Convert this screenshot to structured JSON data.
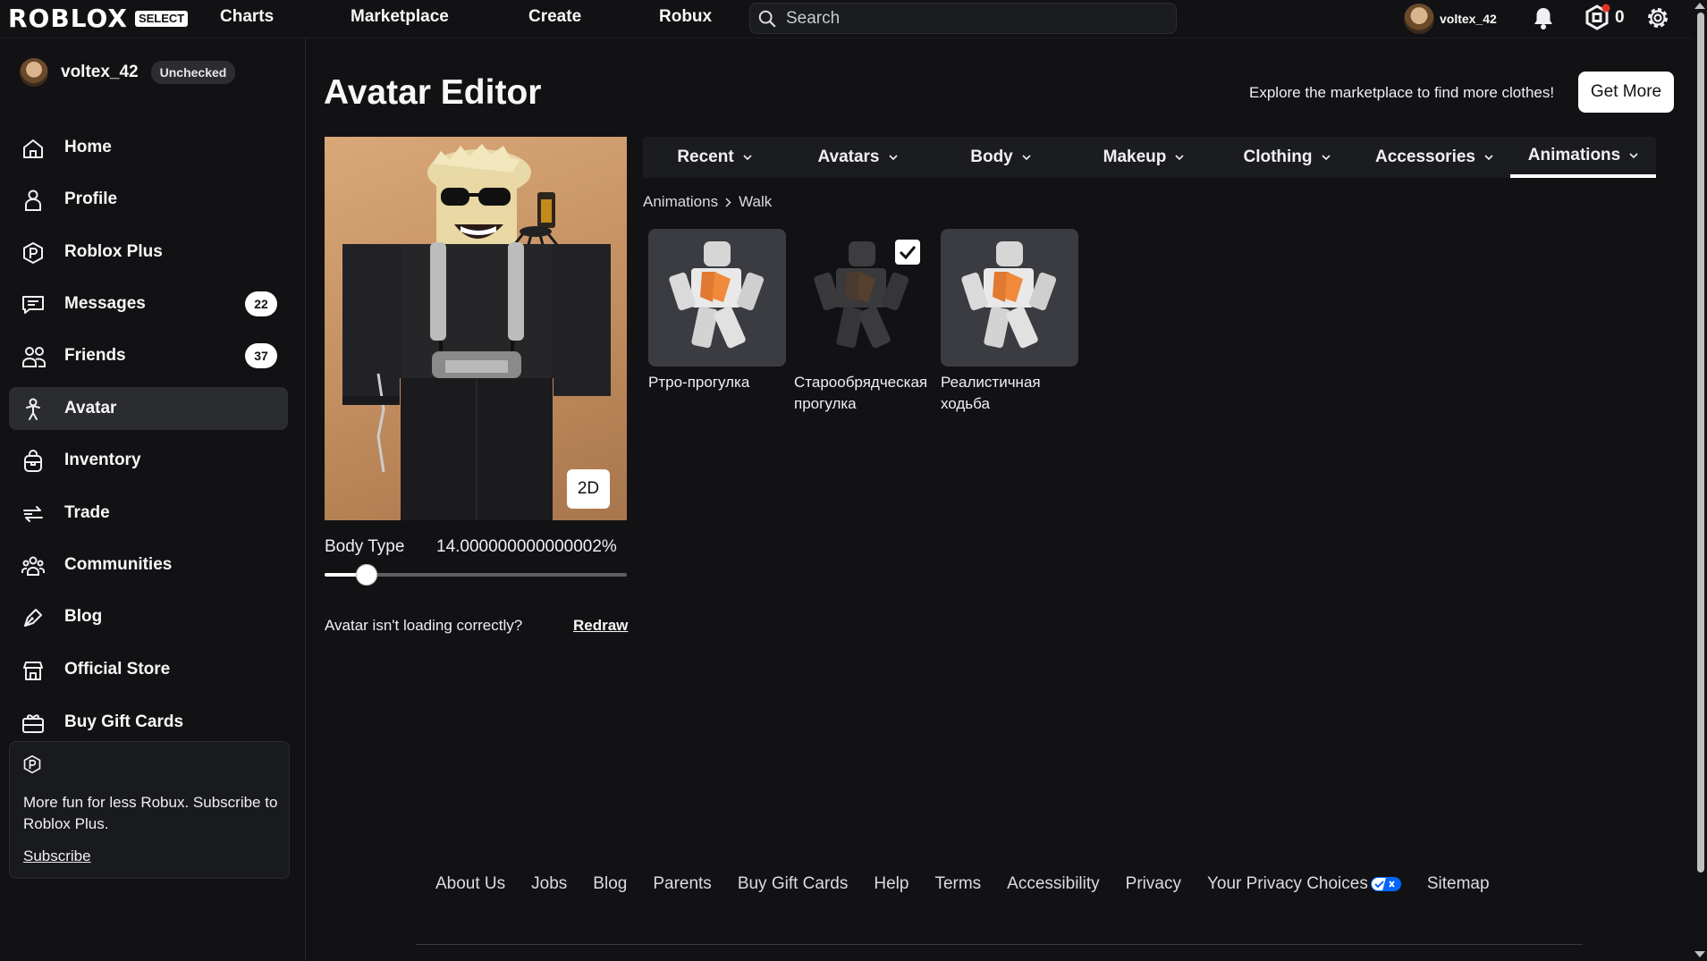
{
  "nav": {
    "logo_text": "ROBLOX",
    "logo_badge": "SELECT",
    "links": [
      "Charts",
      "Marketplace",
      "Create",
      "Robux"
    ],
    "search_placeholder": "Search",
    "username": "voltex_42",
    "robux_count": "0"
  },
  "sidebar": {
    "username": "voltex_42",
    "account_badge": "Unchecked",
    "items": [
      {
        "label": "Home",
        "icon": "home-icon"
      },
      {
        "label": "Profile",
        "icon": "profile-icon"
      },
      {
        "label": "Roblox Plus",
        "icon": "roblox-plus-icon"
      },
      {
        "label": "Messages",
        "icon": "messages-icon",
        "badge": "22"
      },
      {
        "label": "Friends",
        "icon": "friends-icon",
        "badge": "37"
      },
      {
        "label": "Avatar",
        "icon": "avatar-icon",
        "active": true
      },
      {
        "label": "Inventory",
        "icon": "inventory-icon"
      },
      {
        "label": "Trade",
        "icon": "trade-icon"
      },
      {
        "label": "Communities",
        "icon": "communities-icon"
      },
      {
        "label": "Blog",
        "icon": "blog-icon"
      },
      {
        "label": "Official Store",
        "icon": "store-icon"
      },
      {
        "label": "Buy Gift Cards",
        "icon": "gift-card-icon"
      }
    ],
    "promo": {
      "text": "More fun for less Robux. Subscribe to Roblox Plus.",
      "link": "Subscribe"
    }
  },
  "main": {
    "title": "Avatar Editor",
    "explore_text": "Explore the marketplace to find more clothes!",
    "get_more": "Get More",
    "view_toggle": "2D",
    "body_type": {
      "label": "Body Type",
      "value_text": "14.000000000000002%",
      "value": 0.14
    },
    "help_text": "Avatar isn't loading correctly?",
    "redraw": "Redraw",
    "tabs": [
      {
        "label": "Recent"
      },
      {
        "label": "Avatars"
      },
      {
        "label": "Body"
      },
      {
        "label": "Makeup"
      },
      {
        "label": "Clothing"
      },
      {
        "label": "Accessories"
      },
      {
        "label": "Animations",
        "active": true
      }
    ],
    "breadcrumb": [
      "Animations",
      "Walk"
    ],
    "items": [
      {
        "name": "Ртро-прогулка",
        "selected": false
      },
      {
        "name": "Старообрядческая прогулка",
        "selected": true
      },
      {
        "name": "Реалистичная ходьба",
        "selected": false
      }
    ]
  },
  "footer": {
    "links": [
      "About Us",
      "Jobs",
      "Blog",
      "Parents",
      "Buy Gift Cards",
      "Help",
      "Terms",
      "Accessibility",
      "Privacy",
      "Your Privacy Choices",
      "Sitemap"
    ]
  },
  "colors": {
    "background": "#121215",
    "active_item": "#2b2c30",
    "privacy_toggle": "#0066ff"
  }
}
